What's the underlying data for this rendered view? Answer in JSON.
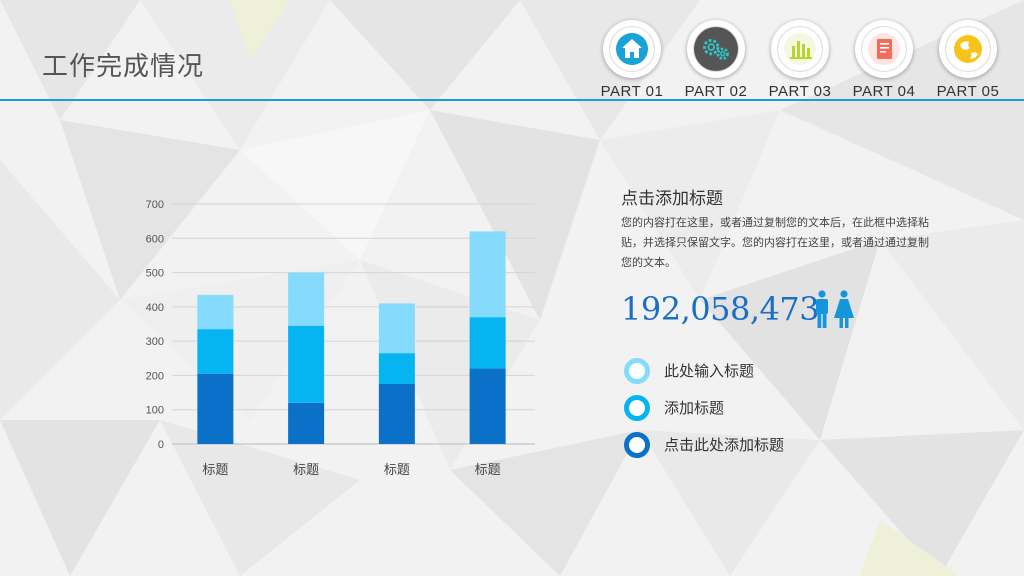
{
  "page": {
    "title": "工作完成情况",
    "accent_color": "#1c9be0"
  },
  "nav": [
    {
      "label": "PART 01",
      "icon": "house-icon",
      "color": "#1aa3d9"
    },
    {
      "label": "PART 02",
      "icon": "gears-icon",
      "color": "#555555"
    },
    {
      "label": "PART 03",
      "icon": "bar-chart-icon",
      "color": "#b7d334"
    },
    {
      "label": "PART 04",
      "icon": "notebook-icon",
      "color": "#f26b5b"
    },
    {
      "label": "PART 05",
      "icon": "globe-icon",
      "color": "#f7c21a"
    }
  ],
  "chart_data": {
    "type": "bar",
    "stacked": true,
    "categories": [
      "标题",
      "标题",
      "标题",
      "标题"
    ],
    "series": [
      {
        "values": [
          205,
          120,
          175,
          220
        ],
        "color": "#0a70c8"
      },
      {
        "values": [
          130,
          225,
          90,
          150
        ],
        "color": "#06b4f2"
      },
      {
        "values": [
          100,
          155,
          145,
          250
        ],
        "color": "#84dbfb"
      }
    ],
    "yticks": [
      0,
      100,
      200,
      300,
      400,
      500,
      600,
      700
    ],
    "ylim": [
      0,
      700
    ],
    "grid": true
  },
  "info": {
    "title": "点击添加标题",
    "body": "您的内容打在这里，或者通过复制您的文本后，在此框中选择粘贴，并选择只保留文字。您的内容打在这里，或者通过通过复制您的文本。",
    "number": "192,058,473",
    "number_color": "#1a6fc4",
    "people_icon": "male-female-icon",
    "people_color": "#1596dc"
  },
  "legend": [
    {
      "label": "此处输入标题",
      "color": "#84dbfb"
    },
    {
      "label": "添加标题",
      "color": "#06b4f2"
    },
    {
      "label": "点击此处添加标题",
      "color": "#0a70c8"
    }
  ]
}
